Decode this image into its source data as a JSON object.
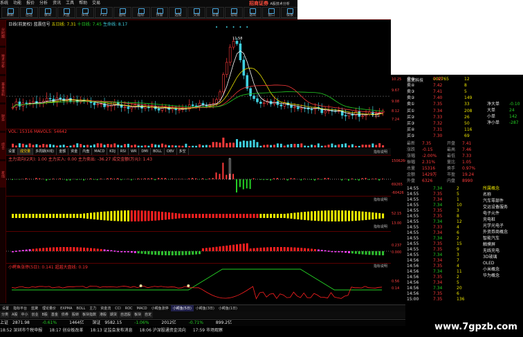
{
  "brand": "招商证券",
  "window_title": "A股技术分析",
  "menu": [
    "系统",
    "功能",
    "报价",
    "分析",
    "资讯",
    "工具",
    "帮助",
    "交易"
  ],
  "toolbar": [
    "刷新",
    "自选",
    "板块",
    "大盘",
    "资讯",
    "F10",
    "画线",
    "指标",
    "预警",
    "选股",
    "交易",
    "设置",
    "帮助",
    "退出",
    "窗口",
    "模板"
  ],
  "leftbar": [
    "分时图",
    "技术分析",
    "基本资料",
    "财务",
    "综合",
    "星线"
  ],
  "main_chart": {
    "title": "日线(前复权) 蓝震信号",
    "ma_labels": [
      "五日线: 7.31",
      "十日线: 7.45",
      "生命线: 8.17"
    ],
    "price_max_label": "11.58",
    "right_axis": [
      "10.25",
      "9.67",
      "9.08",
      "8.12",
      "7.24",
      "6.50"
    ],
    "last_price_label": "7.11"
  },
  "volume_panel": {
    "title": "VOL: 15316 MAVOL5: 54642"
  },
  "tabs": [
    "设置",
    "成交量",
    "多周期(K线)",
    "金额",
    "资金",
    "内盘",
    "MACD",
    "KDJ",
    "RSI",
    "WR",
    "DMI",
    "BOLL",
    "OBV",
    "多空"
  ],
  "active_tab": "成交量",
  "panel2": {
    "title": "主力流向(2天): 1.00  主力买入: 0.00  主力卖出: -36.27  成交金额(万元): 1.43",
    "hint": "指标说明",
    "axis": [
      "1506266",
      "69265",
      "-60426"
    ]
  },
  "panel3": {
    "hint": "指标说明",
    "axis": [
      "52.15",
      "13.00"
    ]
  },
  "panel4": {
    "hint": "指标说明",
    "axis": [
      "0.237",
      "0.000"
    ]
  },
  "panel5": {
    "title": "小鳄鱼涨停(5日): 0.141  超越大盘线: 0.19",
    "hint": "指标说明",
    "axis": [
      "0.56",
      "0.14"
    ]
  },
  "quote": {
    "name": "蓝黛科技",
    "code": "002765",
    "sell_rows": [
      {
        "label": "卖⑤",
        "price": "7.43",
        "vol": "12"
      },
      {
        "label": "卖④",
        "price": "7.42",
        "vol": "8"
      },
      {
        "label": "卖③",
        "price": "7.41",
        "vol": "5"
      },
      {
        "label": "卖②",
        "price": "7.40",
        "vol": "149"
      },
      {
        "label": "卖①",
        "price": "7.35",
        "vol": "33"
      }
    ],
    "buy_rows": [
      {
        "label": "买①",
        "price": "7.34",
        "vol": "208"
      },
      {
        "label": "买②",
        "price": "7.33",
        "vol": "26"
      },
      {
        "label": "买③",
        "price": "7.32",
        "vol": "50"
      },
      {
        "label": "买④",
        "price": "7.31",
        "vol": "116"
      },
      {
        "label": "买⑤",
        "price": "7.30",
        "vol": "69"
      }
    ],
    "stats": [
      {
        "k": "最新",
        "v": "7.35",
        "k2": "开盘",
        "v2": "7.41"
      },
      {
        "k": "涨跌",
        "v": "-0.15",
        "k2": "最高",
        "v2": "7.46"
      },
      {
        "k": "涨幅",
        "v": "-2.00%",
        "k2": "最低",
        "v2": "7.33"
      },
      {
        "k": "振幅",
        "v": "2.31%",
        "k2": "量比",
        "v2": "1.05"
      },
      {
        "k": "总量",
        "v": "15316",
        "k2": "换手",
        "v2": "0.97%"
      },
      {
        "k": "金额",
        "v": "1429万",
        "k2": "市盈",
        "v2": "19.24"
      },
      {
        "k": "外盘",
        "v": "6326",
        "k2": "内盘",
        "v2": "8990"
      }
    ],
    "flows": [
      {
        "k": "净大单",
        "v": "-0.10"
      },
      {
        "k": "大单",
        "v": "24"
      },
      {
        "k": "小单",
        "v": "142"
      },
      {
        "k": "净小单",
        "v": "-287"
      }
    ]
  },
  "ticks": [
    {
      "t": "14:55",
      "p": "7.34",
      "v": "2"
    },
    {
      "t": "14:55",
      "p": "7.35",
      "v": "5"
    },
    {
      "t": "14:55",
      "p": "7.34",
      "v": "1"
    },
    {
      "t": "14:55",
      "p": "7.34",
      "v": "10"
    },
    {
      "t": "14:55",
      "p": "7.35",
      "v": "3"
    },
    {
      "t": "14:55",
      "p": "7.35",
      "v": "8"
    },
    {
      "t": "14:55",
      "p": "7.34",
      "v": "12"
    },
    {
      "t": "14:55",
      "p": "7.33",
      "v": "4"
    },
    {
      "t": "14:55",
      "p": "7.34",
      "v": "6"
    },
    {
      "t": "14:55",
      "p": "7.34",
      "v": "2"
    },
    {
      "t": "14:55",
      "p": "7.35",
      "v": "15"
    },
    {
      "t": "14:55",
      "p": "7.35",
      "v": "9"
    },
    {
      "t": "14:55",
      "p": "7.34",
      "v": "3"
    },
    {
      "t": "14:56",
      "p": "7.34",
      "v": "7"
    },
    {
      "t": "14:56",
      "p": "7.35",
      "v": "4"
    },
    {
      "t": "14:56",
      "p": "7.34",
      "v": "11"
    },
    {
      "t": "14:56",
      "p": "7.35",
      "v": "2"
    },
    {
      "t": "14:56",
      "p": "7.34",
      "v": "5"
    },
    {
      "t": "14:56",
      "p": "7.34",
      "v": "20"
    },
    {
      "t": "14:56",
      "p": "7.35",
      "v": "6"
    },
    {
      "t": "15:00",
      "p": "7.35",
      "v": "136"
    }
  ],
  "concepts": [
    "所属概念",
    "名称",
    "汽车零部件",
    "交运设备服务",
    "电子元件",
    "充电桩",
    "光学光电子",
    "外资券商概念",
    "智能汽车",
    "触摸屏",
    "无线充电",
    "3D玻璃",
    "OLED",
    "小米概念",
    "华为概念"
  ],
  "bottom_tabs": [
    "设置",
    "指标平台",
    "蓝黛",
    "理论量价",
    "EXPMA",
    "BOLL",
    "主力",
    "资金流",
    "CCI",
    "ROC",
    "MACD",
    "小鳄鱼涨停",
    "小鳄鱼(5日)",
    "小鳄鱼(3日)",
    "小鳄鱼(1日)"
  ],
  "bottom_active": "小鳄鱼(5日)",
  "page_tabs": [
    "分类",
    "A股",
    "中小",
    "创业",
    "B股",
    "基金",
    "债券",
    "股转",
    "板块指数",
    "港股",
    "期货",
    "自选股",
    "板块",
    "自定"
  ],
  "status": [
    {
      "t": "上证",
      "v": "2871.98",
      "c": "wht"
    },
    {
      "t": "",
      "v": "-0.61%",
      "c": "grn"
    },
    {
      "t": "",
      "v": "1464亿",
      "c": "wht"
    },
    {
      "t": "深证",
      "v": "9582.15",
      "c": "wht"
    },
    {
      "t": "",
      "v": "-1.06%",
      "c": "grn"
    },
    {
      "t": "",
      "v": "2012亿",
      "c": "wht"
    },
    {
      "t": "",
      "v": "-0.71%",
      "c": "grn"
    },
    {
      "t": "",
      "v": "899.2亿",
      "c": "wht"
    }
  ],
  "ticker": [
    "18:52 深圳市个税申报",
    "18:17 创业板改革",
    "18:13 证监会发布消息",
    "18:06 沪深股通资金流向",
    "17:59 市场观察"
  ],
  "watermark": "www.7gpzb.com",
  "colors": {
    "up": "#ff3b3b",
    "down": "#25d025",
    "bg": "#000000",
    "accent": "#ffd000"
  }
}
